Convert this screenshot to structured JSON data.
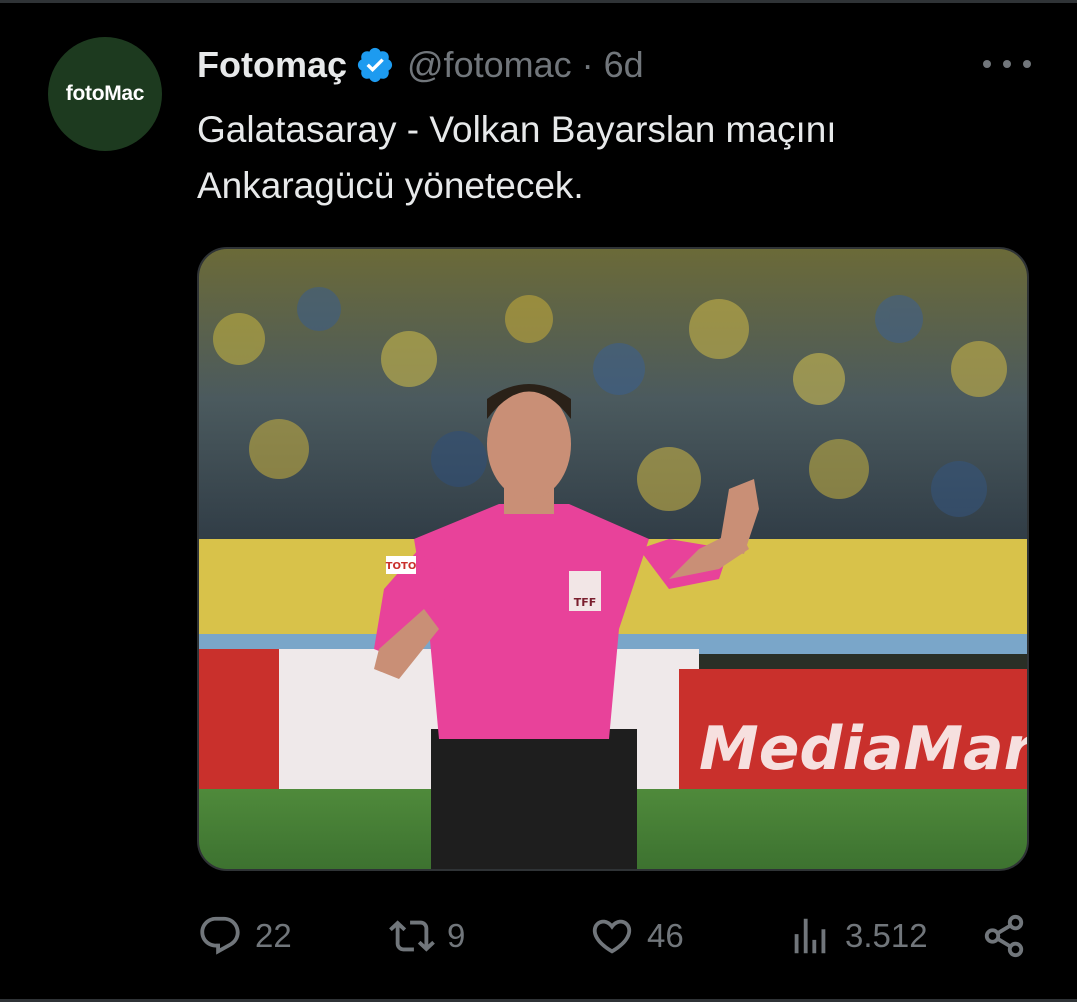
{
  "tweet": {
    "avatar_text": "fotoMac",
    "name": "Fotomaç",
    "handle": "@fotomac",
    "separator": "·",
    "time": "6d",
    "text": "Galatasaray - Volkan Bayarslan maçını\nAnkaragücü yönetecek.",
    "media": {
      "description_icon": "photo-of-referee",
      "jersey_sponsor": "TOTO",
      "badge_text": "TFF",
      "billboard_brand": "MediaMarkt"
    },
    "actions": {
      "replies": "22",
      "retweets": "9",
      "likes": "46",
      "views": "3.512"
    },
    "icons": {
      "verified": "verified-badge-icon",
      "more": "more-icon",
      "reply": "reply-icon",
      "retweet": "retweet-icon",
      "like": "heart-icon",
      "views": "views-icon",
      "share": "share-icon"
    },
    "colors": {
      "background": "#000000",
      "text": "#e7e9ea",
      "muted": "#71767b",
      "verified": "#1d9bf0",
      "avatar_bg": "#1d3a1f"
    }
  }
}
